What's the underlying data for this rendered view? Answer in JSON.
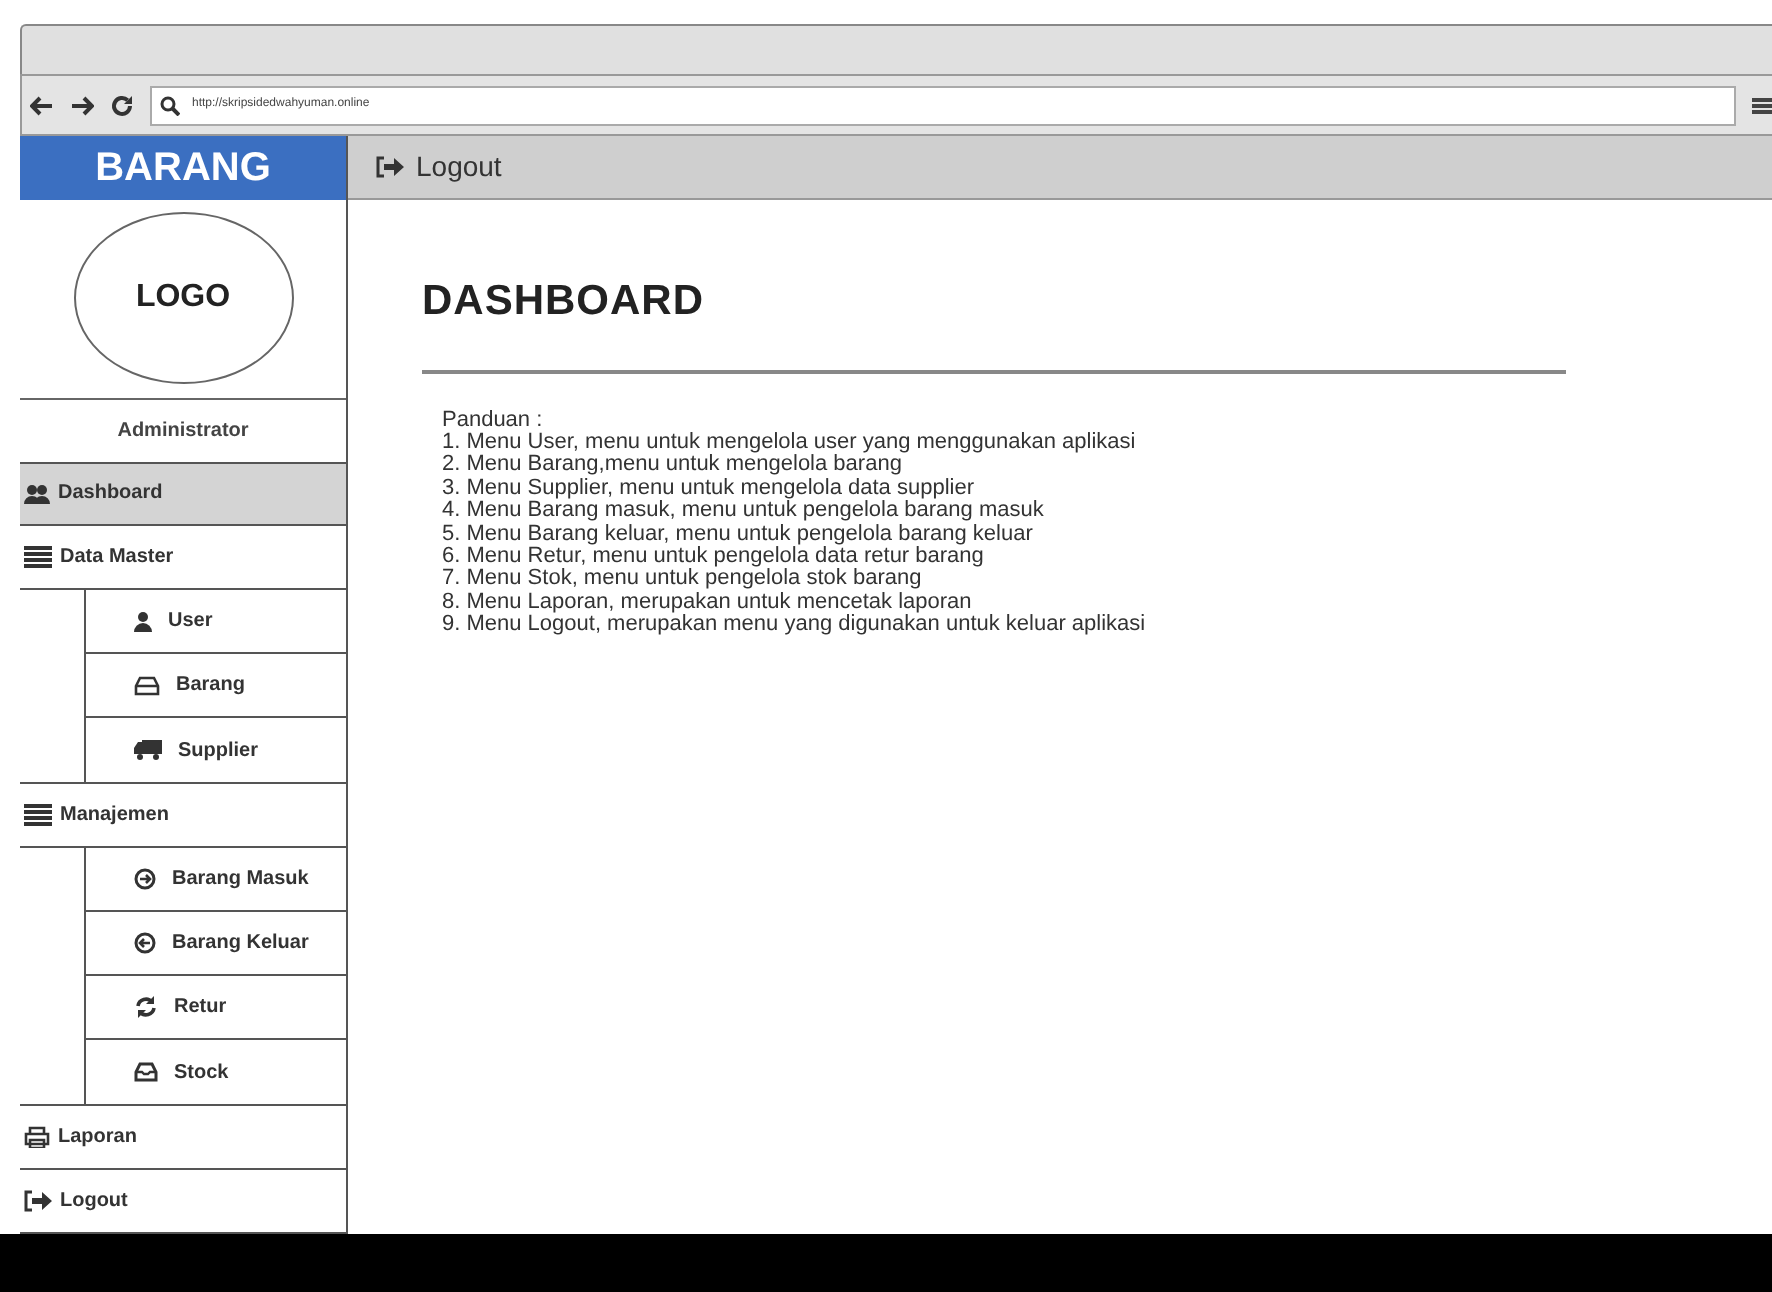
{
  "browser": {
    "url": "http://skripsidedwahyuman.online"
  },
  "sidebar": {
    "brand": "BARANG",
    "logo": "LOGO",
    "user": "Administrator",
    "items": [
      {
        "label": "Dashboard",
        "selected": true
      },
      {
        "label": "Data Master",
        "selected": false,
        "children": [
          {
            "label": "User",
            "selected": false
          },
          {
            "label": "Barang",
            "selected": false
          },
          {
            "label": "Supplier",
            "selected": false
          }
        ]
      },
      {
        "label": "Manajemen",
        "selected": false,
        "children": [
          {
            "label": "Barang Masuk",
            "selected": false
          },
          {
            "label": "Barang Keluar",
            "selected": false
          },
          {
            "label": "Retur",
            "selected": false
          },
          {
            "label": "Stock",
            "selected": false
          }
        ]
      },
      {
        "label": "Laporan",
        "selected": false
      },
      {
        "label": "Logout",
        "selected": false
      }
    ]
  },
  "topbar": {
    "logout": "Logout"
  },
  "main": {
    "title": "DASHBOARD",
    "guide_title": "Panduan :",
    "guide": [
      "1. Menu User, menu untuk mengelola user yang menggunakan aplikasi",
      "2. Menu Barang,menu untuk mengelola barang",
      "3. Menu Supplier, menu untuk mengelola data supplier",
      "4. Menu Barang masuk, menu untuk pengelola barang masuk",
      "5. Menu Barang keluar, menu untuk pengelola barang keluar",
      "6. Menu Retur, menu untuk pengelola data retur barang",
      "7. Menu Stok, menu untuk pengelola stok barang",
      "8. Menu Laporan, merupakan untuk mencetak laporan",
      "9. Menu Logout, merupakan menu yang digunakan untuk keluar aplikasi"
    ]
  }
}
